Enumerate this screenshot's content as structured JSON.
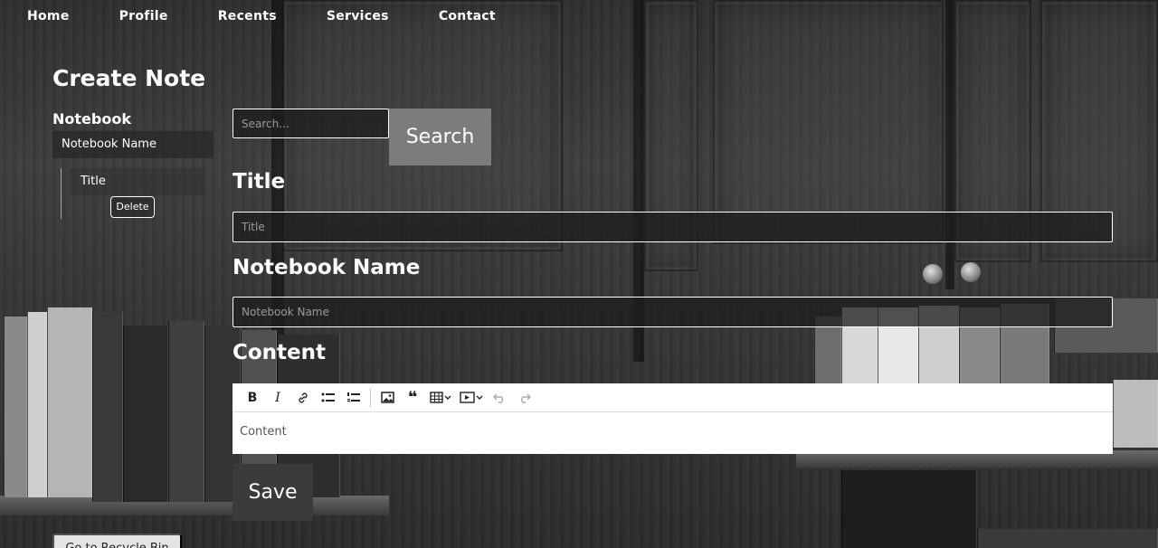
{
  "nav": {
    "home": "Home",
    "profile": "Profile",
    "recents": "Recents",
    "services": "Services",
    "contact": "Contact"
  },
  "sidebar": {
    "title": "Create Note",
    "notebook_heading": "Notebook",
    "notebook_name": "Notebook Name",
    "notes": [
      {
        "title": "Title",
        "delete_label": "Delete"
      }
    ],
    "recycle_label": "Go to Recycle Bin"
  },
  "search": {
    "placeholder": "Search...",
    "button_label": "Search"
  },
  "form": {
    "title_label": "Title",
    "title_placeholder": "Title",
    "notebook_label": "Notebook Name",
    "notebook_placeholder": "Notebook Name",
    "content_label": "Content",
    "content_placeholder": "Content",
    "save_label": "Save"
  },
  "toolbar": {
    "bold": "B",
    "italic": "I",
    "icons": [
      "bold-icon",
      "italic-icon",
      "link-icon",
      "bulleted-list-icon",
      "numbered-list-icon",
      "image-icon",
      "quote-icon",
      "table-icon",
      "media-icon",
      "undo-icon",
      "redo-icon"
    ]
  },
  "colors": {
    "search_button": "#7c7c7c",
    "save_button": "#3b3b3b",
    "recycle_button": "#e4e4e4"
  }
}
